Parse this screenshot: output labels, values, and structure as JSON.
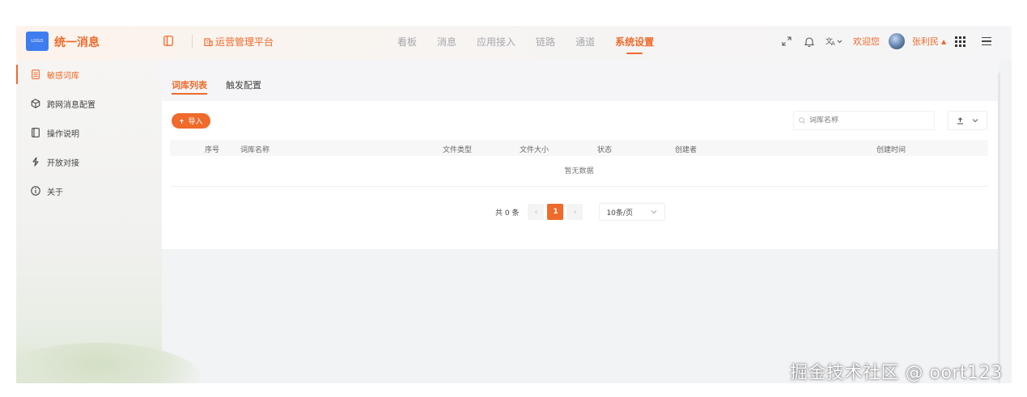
{
  "header": {
    "logo_text": "LOGO",
    "app_title": "统一消息",
    "platform_name": "运营管理平台",
    "nav": [
      "看板",
      "消息",
      "应用接入",
      "链路",
      "通道",
      "系统设置"
    ],
    "active_nav": "系统设置",
    "welcome_text": "欢迎您",
    "username": "张利民"
  },
  "sidebar": {
    "items": [
      {
        "label": "敏感词库",
        "icon": "document-icon",
        "active": true
      },
      {
        "label": "跨网消息配置",
        "icon": "cube-icon",
        "active": false
      },
      {
        "label": "操作说明",
        "icon": "book-icon",
        "active": false
      },
      {
        "label": "开放对接",
        "icon": "link-icon",
        "active": false
      },
      {
        "label": "关于",
        "icon": "info-icon",
        "active": false
      }
    ]
  },
  "tabs": [
    {
      "label": "词库列表",
      "active": true
    },
    {
      "label": "触发配置",
      "active": false
    }
  ],
  "toolbar": {
    "import_label": "导入",
    "search_placeholder": "词库名称"
  },
  "table": {
    "columns": [
      "序号",
      "词库名称",
      "文件类型",
      "文件大小",
      "状态",
      "创建者",
      "创建时间"
    ],
    "rows": [],
    "empty_text": "暂无数据"
  },
  "pagination": {
    "total_text": "共 0 条",
    "current_page": "1",
    "page_size": "10条/页"
  },
  "colors": {
    "accent": "#ef6a2b",
    "logo_bg": "#3f7cf0"
  },
  "watermark": "掘金技术社区 @ oort123"
}
